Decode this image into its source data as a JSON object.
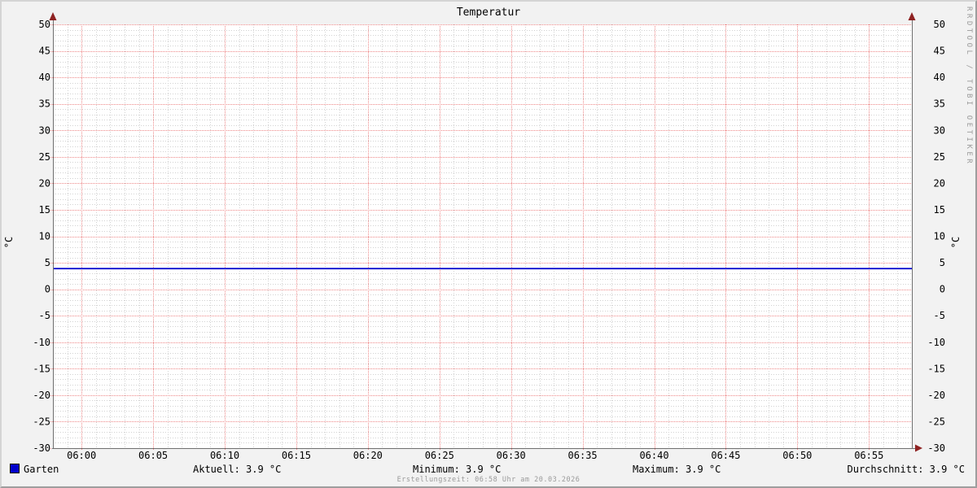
{
  "title": "Temperatur",
  "watermark": "RRDTOOL / TOBI OETIKER",
  "footer": "Erstellungszeit: 06:58 Uhr am 20.03.2026",
  "axis": {
    "left_unit": "°C",
    "right_unit": "°C"
  },
  "legend": {
    "series_label": "Garten",
    "aktuell_label": "Aktuell: 3.9 °C",
    "minimum_label": "Minimum: 3.9 °C",
    "maximum_label": "Maximum: 3.9 °C",
    "durchschnitt_label": "Durchschnitt: 3.9 °C"
  },
  "colors": {
    "background": "#f2f2f2",
    "canvas": "#ffffff",
    "series": "#0000cc",
    "major_grid": "#ee8888",
    "minor_grid": "#d2d2d2",
    "axis": "#6f6f6f",
    "arrow": "#8f2323",
    "text": "#000000",
    "muted_text": "#9a9a9a",
    "border_light": "#d4d4d4",
    "border_dark": "#9e9e9e"
  },
  "chart_data": {
    "type": "line",
    "title": "Temperatur",
    "xlabel": "",
    "ylabel": "°C",
    "ylim": [
      -30,
      50
    ],
    "y_major_step": 5,
    "y_minor_step": 1,
    "y_tick_labels": [
      "-30",
      "-25",
      "-20",
      "-15",
      "-10",
      "-5",
      "0",
      "5",
      "10",
      "15",
      "20",
      "25",
      "30",
      "35",
      "40",
      "45",
      "50"
    ],
    "x_tick_labels": [
      "06:00",
      "06:05",
      "06:10",
      "06:15",
      "06:20",
      "06:25",
      "06:30",
      "06:35",
      "06:40",
      "06:45",
      "06:50",
      "06:55"
    ],
    "x_tick_minutes": [
      0,
      5,
      10,
      15,
      20,
      25,
      30,
      35,
      40,
      45,
      50,
      55
    ],
    "x_range_minutes": [
      -2,
      58
    ],
    "x_minor_step_minutes": 1,
    "grid": true,
    "legend_position": "bottom",
    "series": [
      {
        "name": "Garten",
        "color": "#0000cc",
        "x_minutes": [
          -2,
          58
        ],
        "y": [
          3.9,
          3.9
        ]
      }
    ],
    "stats": {
      "aktuell": 3.9,
      "minimum": 3.9,
      "maximum": 3.9,
      "durchschnitt": 3.9,
      "unit": "°C"
    }
  }
}
